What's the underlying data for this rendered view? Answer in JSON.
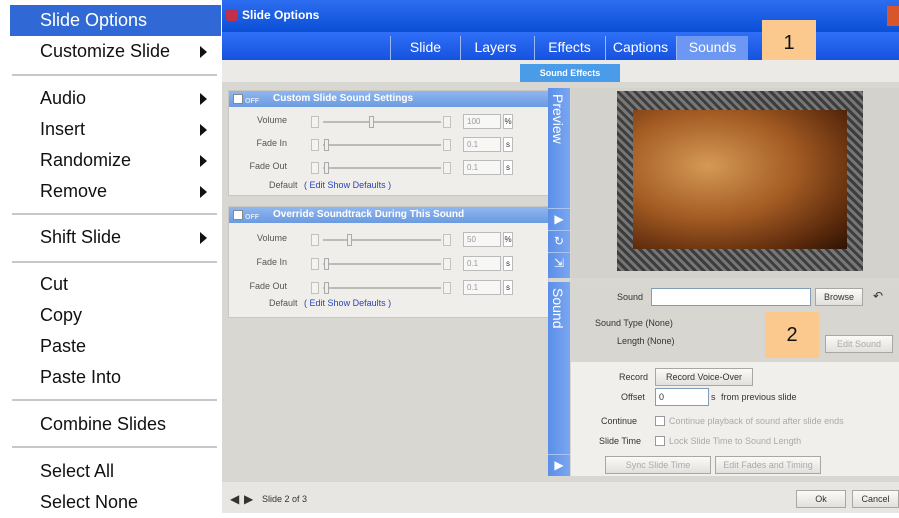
{
  "menu": {
    "items": [
      "Slide Options",
      "Customize Slide",
      "Audio",
      "Insert",
      "Randomize",
      "Remove",
      "Shift Slide",
      "Cut",
      "Copy",
      "Paste",
      "Paste Into",
      "Combine Slides",
      "Select All",
      "Select None"
    ]
  },
  "dialog": {
    "title": "Slide Options",
    "tabs": [
      "Slide",
      "Layers",
      "Effects",
      "Captions",
      "Sounds"
    ],
    "active_tab": "Sounds",
    "subtab": "Sound Effects",
    "annotations": [
      "1",
      "2"
    ],
    "panel1": {
      "title": "Custom Slide Sound Settings",
      "off": "OFF",
      "volume_label": "Volume",
      "fadein_label": "Fade In",
      "fadeout_label": "Fade Out",
      "default_label": "Default",
      "default_link": "( Edit Show Defaults )",
      "volume_value": "100",
      "volume_unit": "%",
      "fadein_value": "0.1",
      "fadein_unit": "s",
      "fadeout_value": "0.1",
      "fadeout_unit": "s"
    },
    "panel2": {
      "title": "Override Soundtrack During This Sound",
      "off": "OFF",
      "volume_label": "Volume",
      "fadein_label": "Fade In",
      "fadeout_label": "Fade Out",
      "default_label": "Default",
      "default_link": "( Edit Show Defaults )",
      "volume_value": "50",
      "volume_unit": "%",
      "fadein_value": "0.1",
      "fadein_unit": "s",
      "fadeout_value": "0.1",
      "fadeout_unit": "s"
    },
    "preview_label": "Preview",
    "sound_label": "Sound",
    "sound": {
      "sound_label": "Sound",
      "browse": "Browse",
      "type_label": "Sound Type",
      "type_value": "(None)",
      "length_label": "Length",
      "length_value": "(None)",
      "edit_sound": "Edit Sound",
      "record_label": "Record",
      "record_btn": "Record Voice-Over",
      "offset_label": "Offset",
      "offset_value": "0",
      "offset_unit": "s",
      "offset_text": "from previous slide",
      "continue_label": "Continue",
      "continue_text": "Continue playback of sound after slide ends",
      "slidetime_label": "Slide Time",
      "slidetime_text": "Lock Slide Time to Sound Length",
      "sync_btn": "Sync Slide Time",
      "fades_btn": "Edit Fades and Timing"
    },
    "footer": {
      "slide": "Slide 2 of 3",
      "ok": "Ok",
      "cancel": "Cancel"
    }
  }
}
